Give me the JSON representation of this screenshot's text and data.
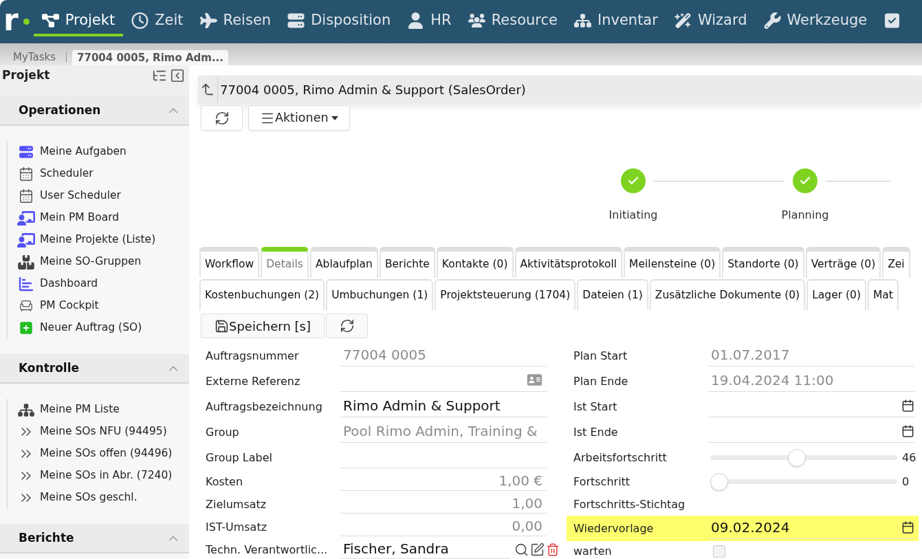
{
  "top_nav": {
    "logo": "r",
    "items": [
      {
        "label": "Projekt",
        "selected": true
      },
      {
        "label": "Zeit",
        "selected": false
      },
      {
        "label": "Reisen",
        "selected": false
      },
      {
        "label": "Disposition",
        "selected": false
      },
      {
        "label": "HR",
        "selected": false
      },
      {
        "label": "Resource",
        "selected": false
      },
      {
        "label": "Inventar",
        "selected": false
      },
      {
        "label": "Wizard",
        "selected": false
      },
      {
        "label": "Werkzeuge",
        "selected": false
      },
      {
        "selected": false
      }
    ]
  },
  "breadcrumbs": [
    {
      "label": "MyTasks",
      "selected": false
    },
    {
      "label": "77004 0005, Rimo Adm...",
      "selected": true
    }
  ],
  "sidebar": {
    "title": "Projekt",
    "sections": [
      {
        "title": "Operationen",
        "expanded": true,
        "items": [
          "Meine Aufgaben",
          "Scheduler",
          "User Scheduler",
          "Mein PM Board",
          "Meine Projekte (Liste)",
          "Meine SO-Gruppen",
          "Dashboard",
          "PM Cockpit",
          "Neuer Auftrag (SO)"
        ]
      },
      {
        "title": "Kontrolle",
        "expanded": true,
        "items": [
          "Meine PM Liste",
          "Meine SOs NFU (94495)",
          "Meine SOs offen (94496)",
          "Meine SOs in Abr. (7240)",
          "Meine SOs geschl."
        ]
      },
      {
        "title": "Berichte",
        "expanded": true
      }
    ]
  },
  "record": {
    "title": "77004 0005, Rimo Admin & Support (SalesOrder)",
    "actions_label": "Aktionen"
  },
  "stepper": {
    "steps": [
      {
        "label": "Initiating",
        "done": true
      },
      {
        "label": "Planning",
        "done": true
      }
    ]
  },
  "tab_strips": [
    {
      "tabs": [
        {
          "label": "Workflow",
          "selected": false
        },
        {
          "label": "Details",
          "selected": true
        },
        {
          "label": "Ablaufplan",
          "selected": false
        },
        {
          "label": "Berichte",
          "selected": false
        },
        {
          "label": "Kontakte (0)",
          "selected": false
        },
        {
          "label": "Aktivitätsprotokoll",
          "selected": false
        },
        {
          "label": "Meilensteine (0)",
          "selected": false
        },
        {
          "label": "Standorte (0)",
          "selected": false
        },
        {
          "label": "Verträge (0)",
          "selected": false
        },
        {
          "label": "Zei",
          "selected": false
        }
      ]
    },
    {
      "tabs": [
        {
          "label": "Kostenbuchungen (2)",
          "selected": false
        },
        {
          "label": "Umbuchungen (1)",
          "selected": false
        },
        {
          "label": "Projektsteuerung (1704)",
          "selected": false
        },
        {
          "label": "Dateien (1)",
          "selected": false
        },
        {
          "label": "Zusätzliche Dokumente (0)",
          "selected": false
        },
        {
          "label": "Lager (0)",
          "selected": false
        },
        {
          "label": "Mat",
          "selected": false
        }
      ]
    }
  ],
  "form": {
    "save_label": "Speichern [s]",
    "left": [
      {
        "label": "Auftragsnummer",
        "kind": "text",
        "value": "77004 0005",
        "readonly": true
      },
      {
        "label": "Externe Referenz",
        "kind": "reference"
      },
      {
        "label": "Auftragsbezeichnung",
        "kind": "text",
        "value": "Rimo Admin & Support",
        "readonly": false
      },
      {
        "label": "Group",
        "kind": "text",
        "value": "Pool Rimo Admin, Training &",
        "readonly": true
      },
      {
        "label": "Group Label",
        "kind": "text"
      },
      {
        "label": "Kosten",
        "kind": "number",
        "value": "1,00 €",
        "readonly": true
      },
      {
        "label": "Zielumsatz",
        "kind": "number",
        "value": "1,00",
        "readonly": true
      },
      {
        "label": "IST-Umsatz",
        "kind": "number",
        "value": "0,00",
        "readonly": true
      },
      {
        "label": "Techn. Verantwortlic...",
        "kind": "lookup",
        "value": "Fischer, Sandra",
        "readonly": false
      }
    ],
    "right": [
      {
        "label": "Plan Start",
        "kind": "text",
        "value": "01.07.2017",
        "readonly": true,
        "highlighted": false
      },
      {
        "label": "Plan Ende",
        "kind": "text",
        "value": "19.04.2024 11:00",
        "readonly": true,
        "highlighted": false
      },
      {
        "label": "Ist Start",
        "kind": "date",
        "highlighted": false
      },
      {
        "label": "Ist Ende",
        "kind": "date",
        "highlighted": false
      },
      {
        "label": "Arbeitsfortschritt",
        "kind": "slider",
        "level": 0.46,
        "reading": "46",
        "highlighted": false
      },
      {
        "label": "Fortschritt",
        "kind": "slider",
        "level": 0,
        "reading": "0",
        "highlighted": false
      },
      {
        "label": "Fortschritts-Stichtag",
        "kind": "blank",
        "highlighted": false
      },
      {
        "label": "Wiedervorlage",
        "kind": "date",
        "value": "09.02.2024",
        "readonly": false,
        "highlighted": true
      },
      {
        "label": "warten",
        "kind": "checkbox",
        "checked": false,
        "highlighted": false
      }
    ]
  }
}
